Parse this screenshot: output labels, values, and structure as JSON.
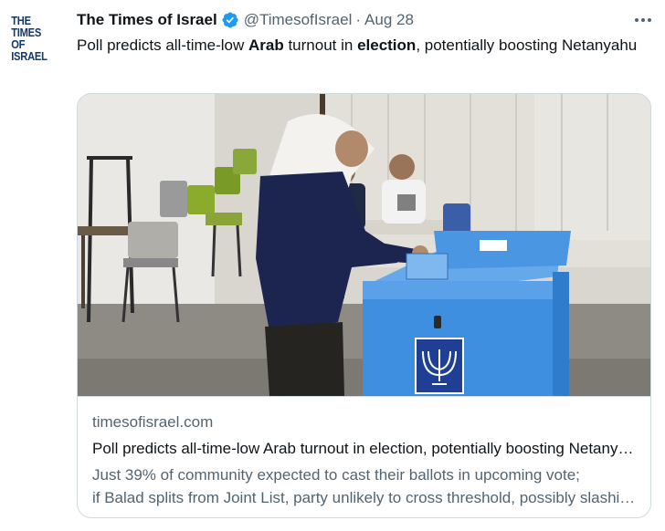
{
  "avatar": {
    "line1": "THE TIMES",
    "line2": "OF ISRAEL"
  },
  "tweet": {
    "author_name": "The Times of Israel",
    "handle": "@TimesofIsrael",
    "separator": "·",
    "date": "Aug 28",
    "text_parts": [
      "Poll predicts all-time-low ",
      "Arab",
      " turnout in ",
      "election",
      ", potentially boosting Netanyahu"
    ]
  },
  "card": {
    "domain": "timesofisrael.com",
    "title": "Poll predicts all-time-low Arab turnout in election, potentially boosting Netanyahu",
    "description_line1": "Just 39% of community expected to cast their ballots in upcoming vote;",
    "description_line2": "if Balad splits from Joint List, party unlikely to cross threshold, possibly slashing Arab representation"
  },
  "icons": {
    "verified": "verified-badge-icon",
    "more": "more-options-icon"
  },
  "colors": {
    "name": "#0f1419",
    "secondary": "#536471",
    "verified": "#1d9bf0",
    "ballot_box": "#3f8fe0",
    "logo": "#13386b",
    "border": "#cfd9de"
  }
}
